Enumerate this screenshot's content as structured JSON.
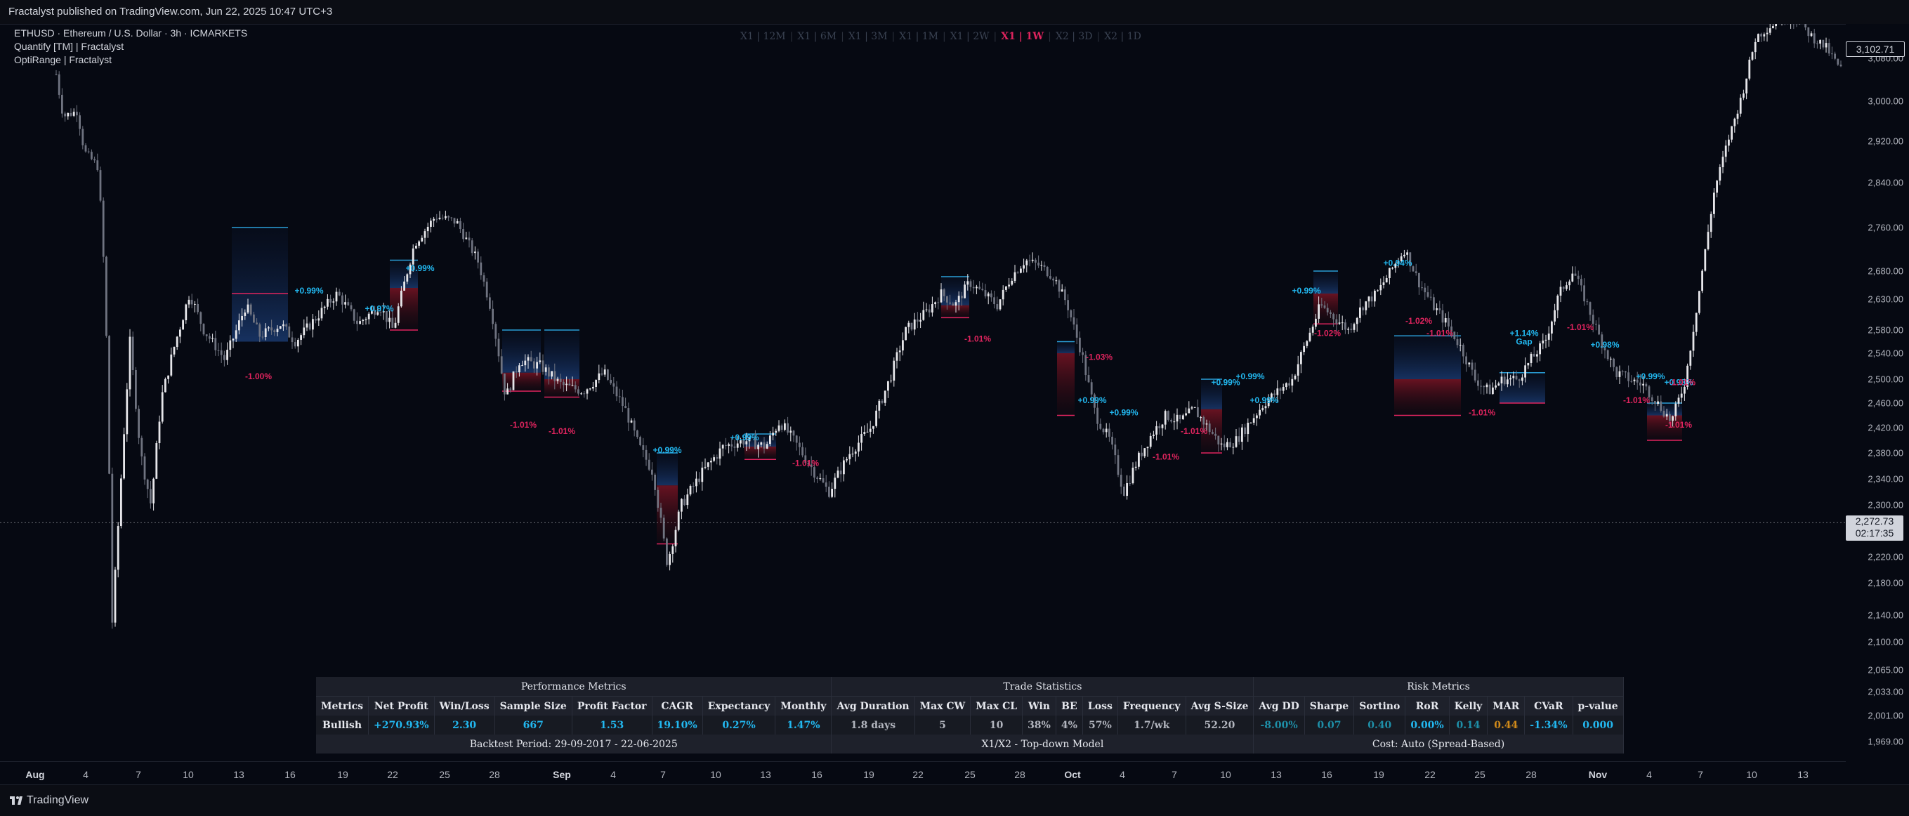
{
  "publisher_line": "Fractalyst published on TradingView.com, Jun 22, 2025 10:47 UTC+3",
  "legend": {
    "symbol": "ETHUSD · Ethereum / U.S. Dollar · 3h · ICMARKETS",
    "indicator1": "Quantify [TM] | Fractalyst",
    "indicator2": "OptiRange | Fractalyst"
  },
  "timeframe_models": [
    {
      "label": "X1 | 12M",
      "active": false
    },
    {
      "label": "X1 | 6M",
      "active": false
    },
    {
      "label": "X1 | 3M",
      "active": false
    },
    {
      "label": "X1 | 1M",
      "active": false
    },
    {
      "label": "X1 | 2W",
      "active": false
    },
    {
      "label": "X1 | 1W",
      "active": true
    },
    {
      "label": "X2 | 3D",
      "active": false
    },
    {
      "label": "X2 | 1D",
      "active": false
    }
  ],
  "price_axis": {
    "ticks": [
      "3,080.00",
      "3,000.00",
      "2,920.00",
      "2,840.00",
      "2,760.00",
      "2,680.00",
      "2,630.00",
      "2,580.00",
      "2,540.00",
      "2,500.00",
      "2,460.00",
      "2,420.00",
      "2,380.00",
      "2,340.00",
      "2,300.00",
      "2,260.00",
      "2,220.00",
      "2,180.00",
      "2,140.00",
      "2,100.00",
      "2,065.00",
      "2,033.00",
      "2,001.00",
      "1,969.00"
    ],
    "tick_values": [
      3080,
      3000,
      2920,
      2840,
      2760,
      2680,
      2630,
      2580,
      2540,
      2500,
      2460,
      2420,
      2380,
      2340,
      2300,
      2260,
      2220,
      2180,
      2140,
      2100,
      2065,
      2033,
      2001,
      1969
    ],
    "top_label": "3,102.71",
    "current_price": "2,272.73",
    "countdown": "02:17:35"
  },
  "time_axis": {
    "ticks": [
      {
        "label": "Aug",
        "month": true
      },
      {
        "label": "4"
      },
      {
        "label": "7"
      },
      {
        "label": "10"
      },
      {
        "label": "13"
      },
      {
        "label": "16"
      },
      {
        "label": "19"
      },
      {
        "label": "22"
      },
      {
        "label": "25"
      },
      {
        "label": "28"
      },
      {
        "label": "Sep",
        "month": true
      },
      {
        "label": "4"
      },
      {
        "label": "7"
      },
      {
        "label": "10"
      },
      {
        "label": "13"
      },
      {
        "label": "16"
      },
      {
        "label": "19"
      },
      {
        "label": "22"
      },
      {
        "label": "25"
      },
      {
        "label": "28"
      },
      {
        "label": "Oct",
        "month": true
      },
      {
        "label": "4"
      },
      {
        "label": "7"
      },
      {
        "label": "10"
      },
      {
        "label": "13"
      },
      {
        "label": "16"
      },
      {
        "label": "19"
      },
      {
        "label": "22"
      },
      {
        "label": "25"
      },
      {
        "label": "28"
      },
      {
        "label": "Nov",
        "month": true
      },
      {
        "label": "4"
      },
      {
        "label": "7"
      },
      {
        "label": "10"
      },
      {
        "label": "13"
      }
    ]
  },
  "trade_labels": [
    {
      "text": "-1.00%",
      "kind": "loss"
    },
    {
      "text": "+0.99%",
      "kind": "win"
    },
    {
      "text": "+0.97%",
      "kind": "win"
    },
    {
      "text": "+0.99%",
      "kind": "win"
    },
    {
      "text": "-1.01%",
      "kind": "loss"
    },
    {
      "text": "-1.01%",
      "kind": "loss"
    },
    {
      "text": "+0.99%",
      "kind": "win"
    },
    {
      "text": "+0.99%",
      "kind": "win"
    },
    {
      "text": "-1.01%",
      "kind": "loss"
    },
    {
      "text": "+0.99%",
      "kind": "win"
    },
    {
      "text": "-1.01%",
      "kind": "loss"
    },
    {
      "text": "+0.99%",
      "kind": "win"
    },
    {
      "text": "-1.03%",
      "kind": "loss"
    },
    {
      "text": "-1.01%",
      "kind": "loss"
    },
    {
      "text": "+0.99%",
      "kind": "win"
    },
    {
      "text": "-1.01%",
      "kind": "loss"
    },
    {
      "text": "+0.99%",
      "kind": "win"
    },
    {
      "text": "-1.02%",
      "kind": "loss"
    },
    {
      "text": "+0.99%",
      "kind": "win"
    },
    {
      "text": "+0.99%",
      "kind": "win"
    },
    {
      "text": "+0.94%",
      "kind": "win"
    },
    {
      "text": "-1.02%",
      "kind": "loss"
    },
    {
      "text": "-1.01%",
      "kind": "loss"
    },
    {
      "text": "-1.01%",
      "kind": "loss"
    },
    {
      "text": "+1.14%",
      "kind": "win"
    },
    {
      "text": "Gap",
      "kind": "win"
    },
    {
      "text": "-1.01%",
      "kind": "loss"
    },
    {
      "text": "+0.98%",
      "kind": "win"
    },
    {
      "text": "-1.01%",
      "kind": "loss"
    },
    {
      "text": "+0.99%",
      "kind": "win"
    },
    {
      "text": "-1.01%",
      "kind": "loss"
    },
    {
      "text": "+0.98%",
      "kind": "win"
    },
    {
      "text": "-1.01%",
      "kind": "loss"
    }
  ],
  "metrics_table": {
    "groups": [
      "Performance Metrics",
      "Trade Statistics",
      "Risk Metrics"
    ],
    "headers": [
      "Metrics",
      "Net Profit",
      "Win/Loss",
      "Sample Size",
      "Profit Factor",
      "CAGR",
      "Expectancy",
      "Monthly",
      "Avg Duration",
      "Max CW",
      "Max CL",
      "Win",
      "BE",
      "Loss",
      "Frequency",
      "Avg S-Size",
      "Avg DD",
      "Sharpe",
      "Sortino",
      "RoR",
      "Kelly",
      "MAR",
      "CVaR",
      "p-value"
    ],
    "row": [
      "Bullish",
      "+270.93%",
      "2.30",
      "667",
      "1.53",
      "19.10%",
      "0.27%",
      "1.47%",
      "1.8 days",
      "5",
      "10",
      "38%",
      "4%",
      "57%",
      "1.7/wk",
      "52.20",
      "-8.00%",
      "0.07",
      "0.40",
      "0.00%",
      "0.14",
      "0.44",
      "-1.34%",
      "0.000"
    ],
    "row_colors": [
      "white",
      "cyan",
      "cyan",
      "cyan",
      "cyan",
      "cyan",
      "cyan",
      "cyan",
      "gray",
      "gray",
      "gray",
      "gray",
      "gray",
      "gray",
      "gray",
      "gray",
      "teal",
      "teal",
      "teal",
      "cyan",
      "teal",
      "orange",
      "cyan",
      "cyan"
    ],
    "footer": [
      "Backtest Period: 29-09-2017 - 22-06-2025",
      "X1/X2 - Top-down Model",
      "Cost: Auto (Spread-Based)"
    ]
  },
  "colors": {
    "background": "#060912",
    "win": "#22b8f0",
    "loss": "#e0245e",
    "candle_up": "#e6e6ea",
    "candle_down": "#6f7380",
    "accent_active": "#e0245e"
  },
  "footer_brand": "TradingView"
}
